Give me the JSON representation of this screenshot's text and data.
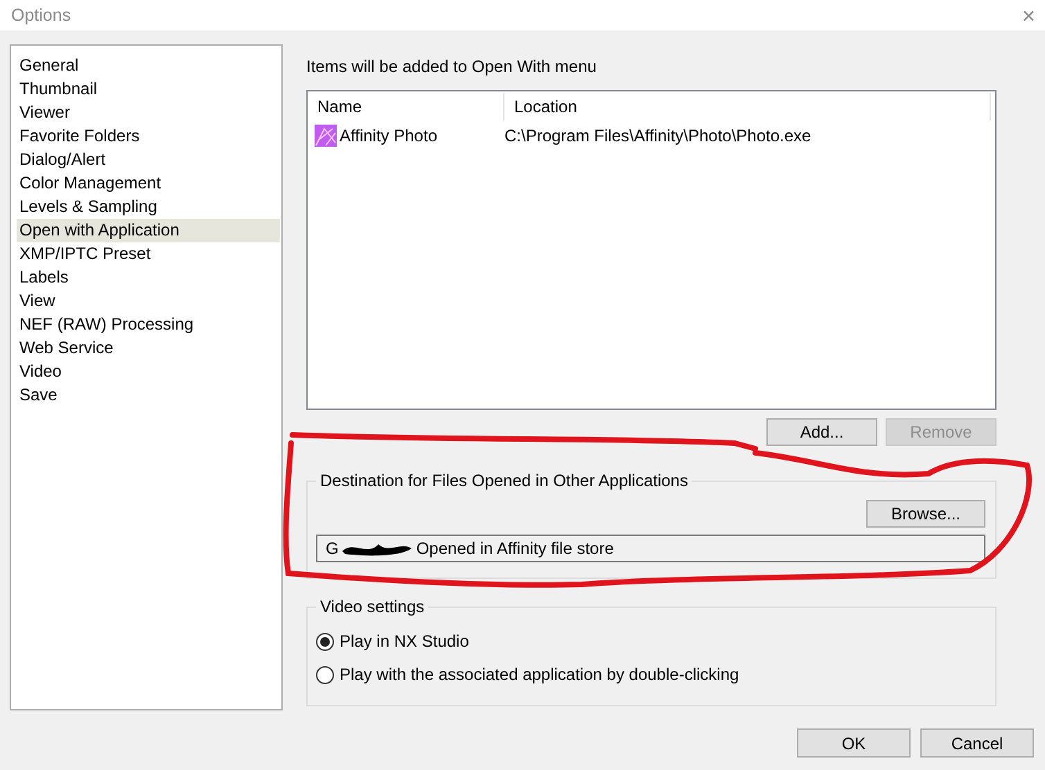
{
  "window": {
    "title": "Options",
    "close": "✕"
  },
  "sidebar": {
    "items": [
      {
        "label": "General",
        "selected": false
      },
      {
        "label": "Thumbnail",
        "selected": false
      },
      {
        "label": "Viewer",
        "selected": false
      },
      {
        "label": "Favorite Folders",
        "selected": false
      },
      {
        "label": "Dialog/Alert",
        "selected": false
      },
      {
        "label": "Color Management",
        "selected": false
      },
      {
        "label": "Levels & Sampling",
        "selected": false
      },
      {
        "label": "Open with Application",
        "selected": true
      },
      {
        "label": "XMP/IPTC Preset",
        "selected": false
      },
      {
        "label": "Labels",
        "selected": false
      },
      {
        "label": "View",
        "selected": false
      },
      {
        "label": "NEF (RAW) Processing",
        "selected": false
      },
      {
        "label": "Web Service",
        "selected": false
      },
      {
        "label": "Video",
        "selected": false
      },
      {
        "label": "Save",
        "selected": false
      }
    ]
  },
  "open_with": {
    "caption": "Items will be added to Open With menu",
    "table": {
      "columns": [
        "Name",
        "Location"
      ],
      "rows": [
        {
          "name": "Affinity Photo",
          "location": "C:\\Program Files\\Affinity\\Photo\\Photo.exe"
        }
      ]
    },
    "buttons": [
      {
        "label": "Add...",
        "disabled": false
      },
      {
        "label": "Remove",
        "disabled": true
      }
    ]
  },
  "destination": {
    "legend": "Destination for Files Opened in Other Applications",
    "browse": "Browse...",
    "value_parts": [
      "G",
      "Opened in Affinity file store"
    ]
  },
  "video": {
    "legend": "Video settings",
    "options": [
      {
        "label": "Play in NX Studio",
        "selected": true
      },
      {
        "label": "Play with the associated application by double-clicking",
        "selected": false
      }
    ]
  },
  "footer": {
    "buttons": [
      "OK",
      "Cancel"
    ]
  }
}
